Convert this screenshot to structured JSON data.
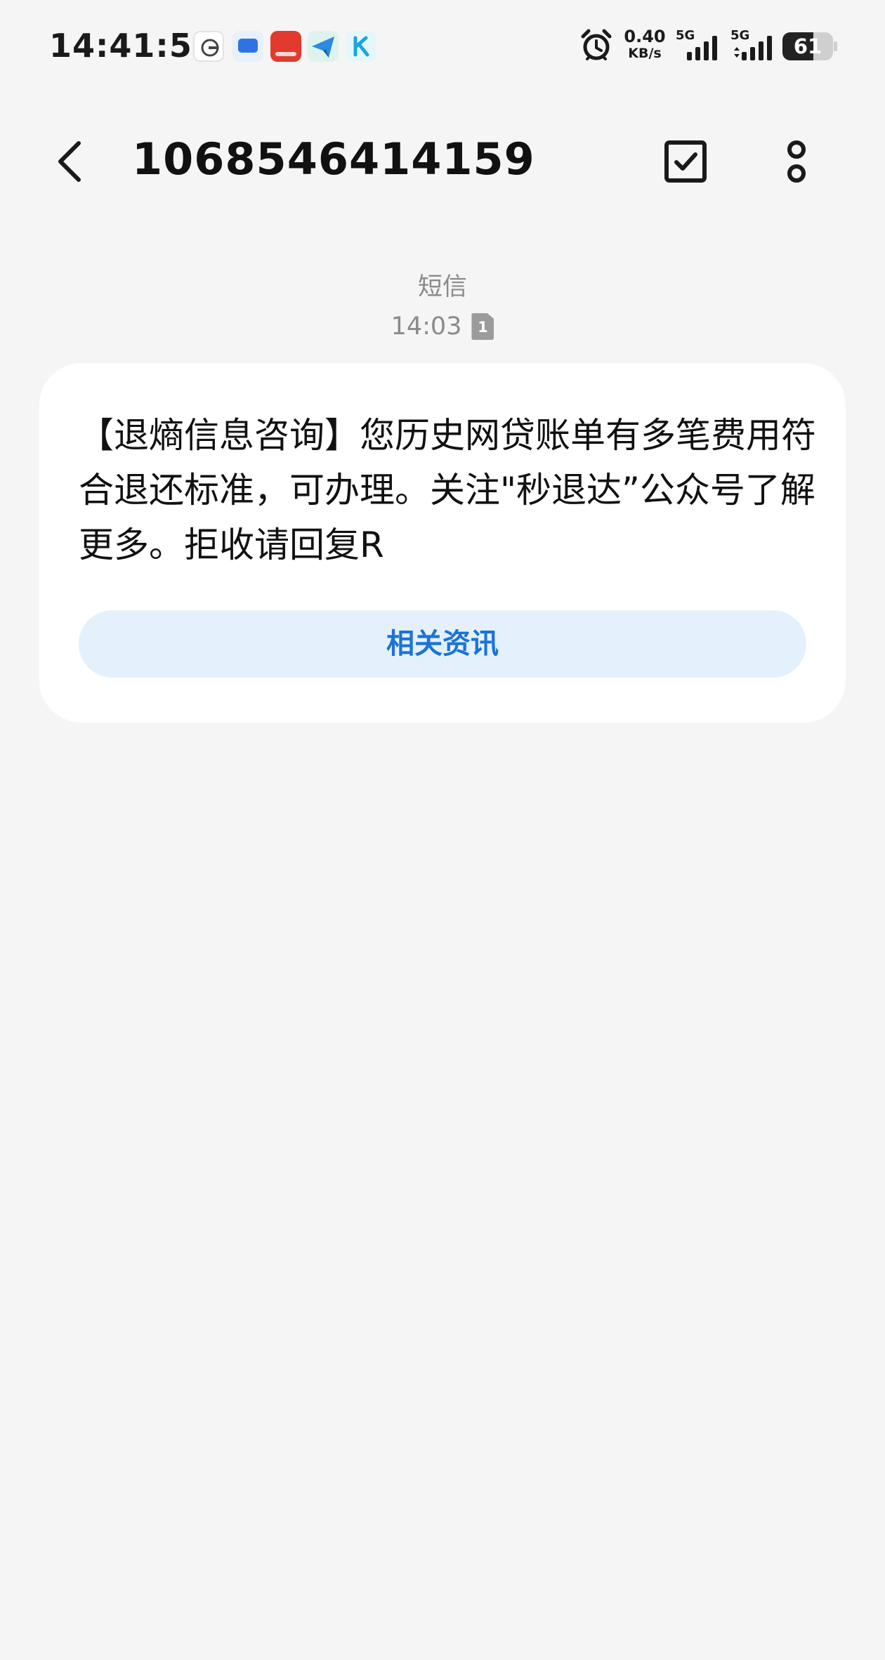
{
  "status_bar": {
    "time": "14:41:50",
    "net_speed_value": "0.40",
    "net_speed_unit": "KB/s",
    "sim1_label": "5G",
    "sim2_label": "5G",
    "battery_level": "61",
    "notification_icons": [
      "app-icon",
      "chat-icon",
      "payment-app-icon",
      "send-icon",
      "k-app-icon"
    ]
  },
  "header": {
    "title": "1068546414159"
  },
  "conversation": {
    "type_label": "短信",
    "time": "14:03",
    "sim_slot": "1"
  },
  "message": {
    "text": "【退熵信息咨询】您历史网贷账单有多笔费用符合退还标准，可办理。关注\"秒退达”公众号了解更多。拒收请回复R",
    "action_label": "相关资讯"
  },
  "colors": {
    "background": "#f5f5f5",
    "card": "#ffffff",
    "action_text": "#1b73d6",
    "action_bg": "#e4f1fd"
  }
}
